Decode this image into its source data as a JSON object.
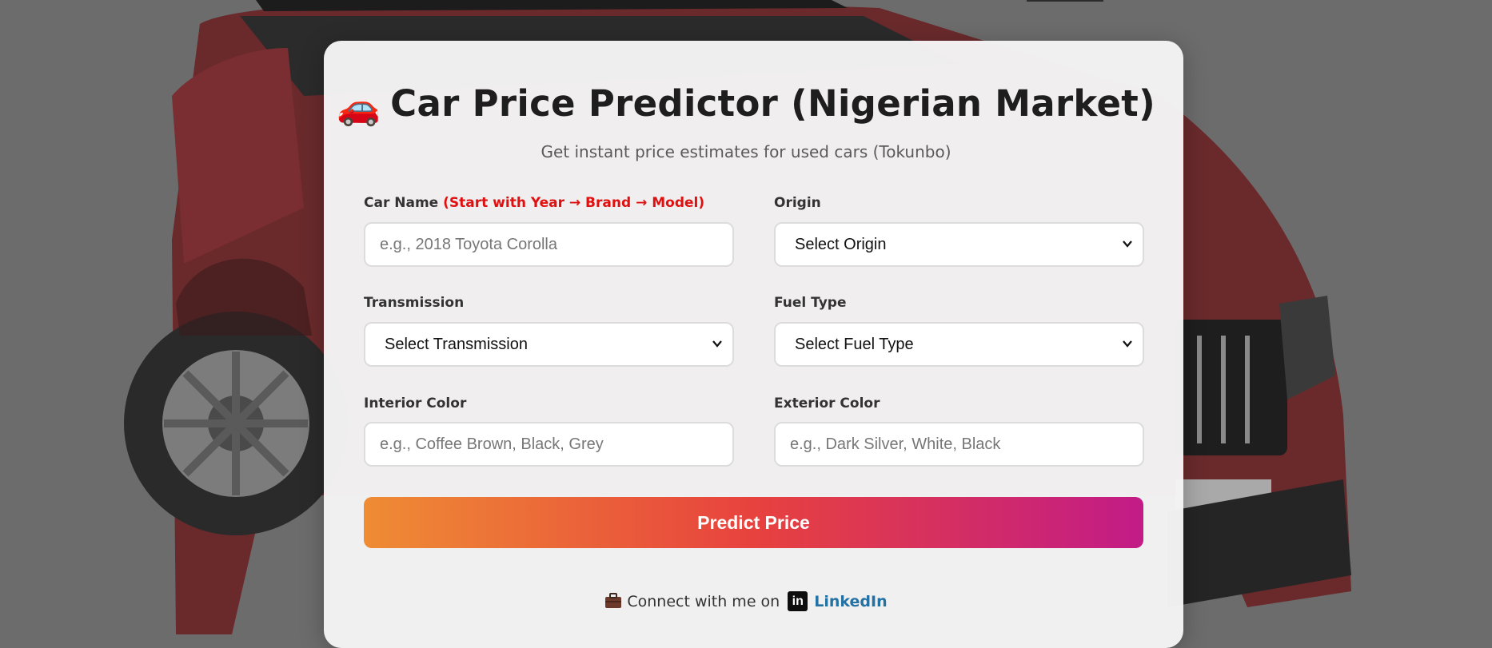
{
  "header": {
    "car_emoji": "🚗",
    "title": "Car Price Predictor (Nigerian Market)",
    "subtitle": "Get instant price estimates for used cars (Tokunbo)"
  },
  "form": {
    "car_name": {
      "label": "Car Name",
      "hint": "(Start with Year → Brand → Model)",
      "placeholder": "e.g., 2018 Toyota Corolla"
    },
    "origin": {
      "label": "Origin",
      "selected": "Select Origin"
    },
    "transmission": {
      "label": "Transmission",
      "selected": "Select Transmission"
    },
    "fuel_type": {
      "label": "Fuel Type",
      "selected": "Select Fuel Type"
    },
    "interior_color": {
      "label": "Interior Color",
      "placeholder": "e.g., Coffee Brown, Black, Grey"
    },
    "exterior_color": {
      "label": "Exterior Color",
      "placeholder": "e.g., Dark Silver, White, Black"
    },
    "submit_label": "Predict Price"
  },
  "footer": {
    "text": "Connect with me on",
    "linkedin_icon_text": "in",
    "link_label": "LinkedIn"
  },
  "icons": {
    "car": "car-emoji",
    "briefcase": "briefcase-icon",
    "linkedin": "linkedin-icon",
    "chevron": "chevron-down-icon"
  },
  "colors": {
    "hint": "#e01010",
    "button_gradient": [
      "#ef8c34",
      "#e7423e",
      "#c21b87"
    ],
    "link": "#2471a3"
  }
}
